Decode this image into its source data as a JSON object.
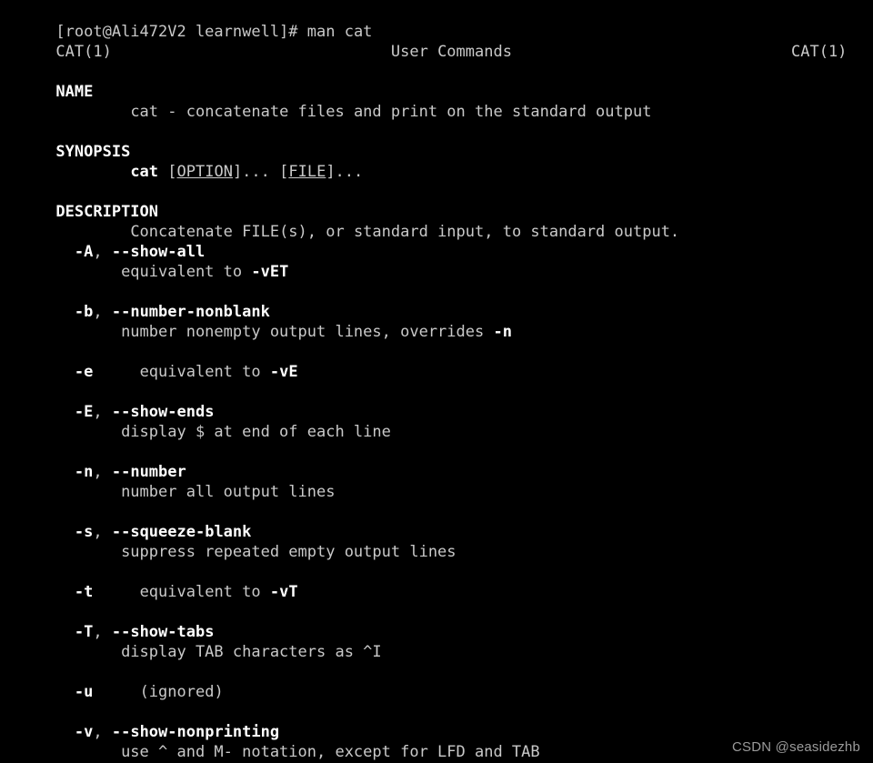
{
  "terminal": {
    "background_color": "#000000",
    "foreground_color": "#c9c9c9",
    "bold_color": "#ffffff",
    "prompt_line": "[root@Ali472V2 learnwell]# man cat"
  },
  "man_page": {
    "header": {
      "left": "CAT(1)",
      "center": "User Commands",
      "right": "CAT(1)"
    },
    "sections": [
      {
        "title": "NAME",
        "body": "cat - concatenate files and print on the standard output"
      },
      {
        "title": "SYNOPSIS",
        "synopsis_command": "cat",
        "synopsis_option": "OPTION",
        "synopsis_file": "FILE",
        "synopsis_brackets_1_open": " [",
        "synopsis_brackets_1_close": "]... [",
        "synopsis_brackets_2_close": "]..."
      },
      {
        "title": "DESCRIPTION",
        "body": "Concatenate FILE(s), or standard input, to standard output."
      }
    ],
    "options": [
      {
        "flag_short": "-A",
        "separator": ", ",
        "flag_long": "--show-all",
        "desc_pre": "equivalent to ",
        "desc_bold": "-vET",
        "desc_post": ""
      },
      {
        "flag_short": "-b",
        "separator": ", ",
        "flag_long": "--number-nonblank",
        "desc_pre": "number nonempty output lines, overrides ",
        "desc_bold": "-n",
        "desc_post": ""
      },
      {
        "flag_short": "-e",
        "separator": "",
        "flag_long": "",
        "inline": true,
        "desc_pre": "equivalent to ",
        "desc_bold": "-vE",
        "desc_post": ""
      },
      {
        "flag_short": "-E",
        "separator": ", ",
        "flag_long": "--show-ends",
        "desc_pre": "display $ at end of each line",
        "desc_bold": "",
        "desc_post": ""
      },
      {
        "flag_short": "-n",
        "separator": ", ",
        "flag_long": "--number",
        "desc_pre": "number all output lines",
        "desc_bold": "",
        "desc_post": ""
      },
      {
        "flag_short": "-s",
        "separator": ", ",
        "flag_long": "--squeeze-blank",
        "desc_pre": "suppress repeated empty output lines",
        "desc_bold": "",
        "desc_post": ""
      },
      {
        "flag_short": "-t",
        "separator": "",
        "flag_long": "",
        "inline": true,
        "desc_pre": "equivalent to ",
        "desc_bold": "-vT",
        "desc_post": ""
      },
      {
        "flag_short": "-T",
        "separator": ", ",
        "flag_long": "--show-tabs",
        "desc_pre": "display TAB characters as ^I",
        "desc_bold": "",
        "desc_post": ""
      },
      {
        "flag_short": "-u",
        "separator": "",
        "flag_long": "",
        "inline": true,
        "desc_pre": "(ignored)",
        "desc_bold": "",
        "desc_post": ""
      },
      {
        "flag_short": "-v",
        "separator": ", ",
        "flag_long": "--show-nonprinting",
        "desc_pre": "use ^ and M- notation, except for LFD and TAB",
        "desc_bold": "",
        "desc_post": ""
      }
    ]
  },
  "watermark": {
    "text": "CSDN @seasidezhb"
  },
  "indent": {
    "section_body": "        ",
    "option_desc": "             ",
    "inline_gap": "     "
  }
}
